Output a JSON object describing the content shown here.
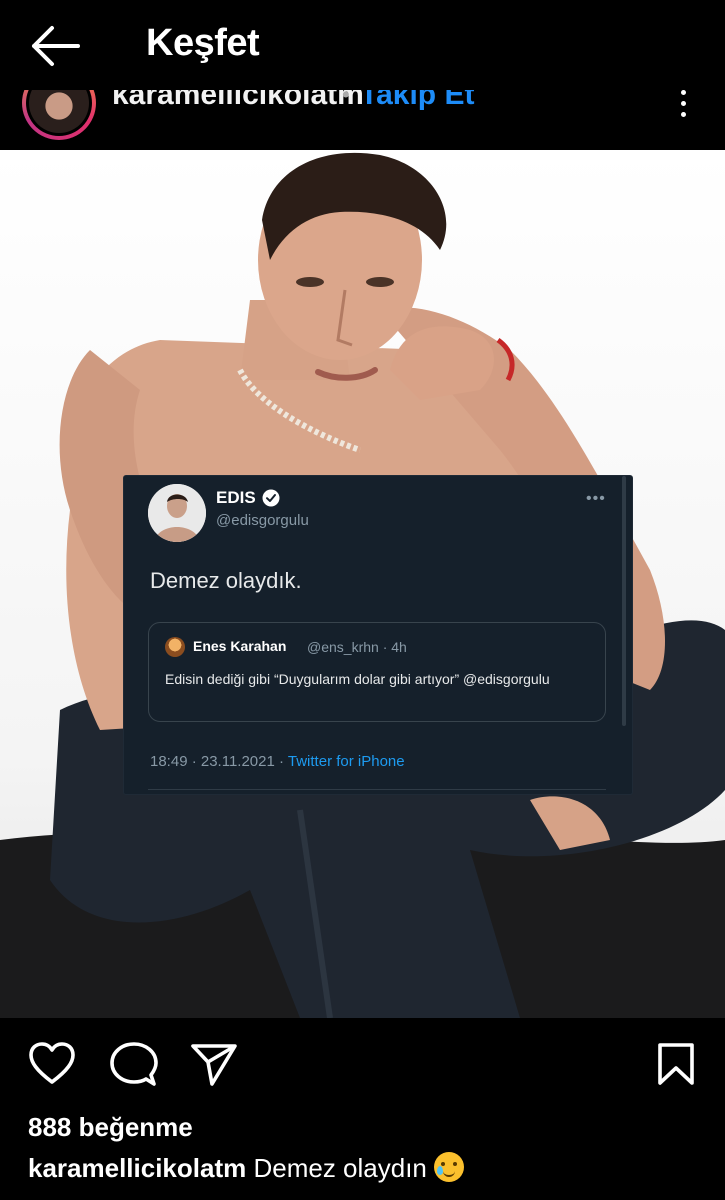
{
  "header": {
    "title": "Keşfet"
  },
  "user": {
    "username": "karamellicikolatm",
    "separator": "•",
    "follow_label": "Takip Et"
  },
  "post": {
    "tweet": {
      "name": "EDIS",
      "handle": "@edisgorgulu",
      "more": "•••",
      "text": "Demez olaydık.",
      "quote": {
        "name": "Enes Karahan",
        "meta": "@ens_krhn · 4h",
        "text": "Edisin dediği gibi “Duygularım dolar gibi artıyor” @edisgorgulu"
      },
      "meta": "18:49 · 23.11.2021 · ",
      "source": "Twitter for iPhone"
    }
  },
  "actions": {
    "icons": [
      "heart-icon",
      "comment-icon",
      "share-icon",
      "bookmark-icon"
    ]
  },
  "likes": "888 beğenme",
  "caption": {
    "user": "karamellicikolatm",
    "text": "Demez olaydın"
  },
  "colors": {
    "background": "#000000",
    "follow": "#1d8cf8",
    "tweet_bg": "#15202b",
    "twitter_blue": "#1d9bf0"
  }
}
